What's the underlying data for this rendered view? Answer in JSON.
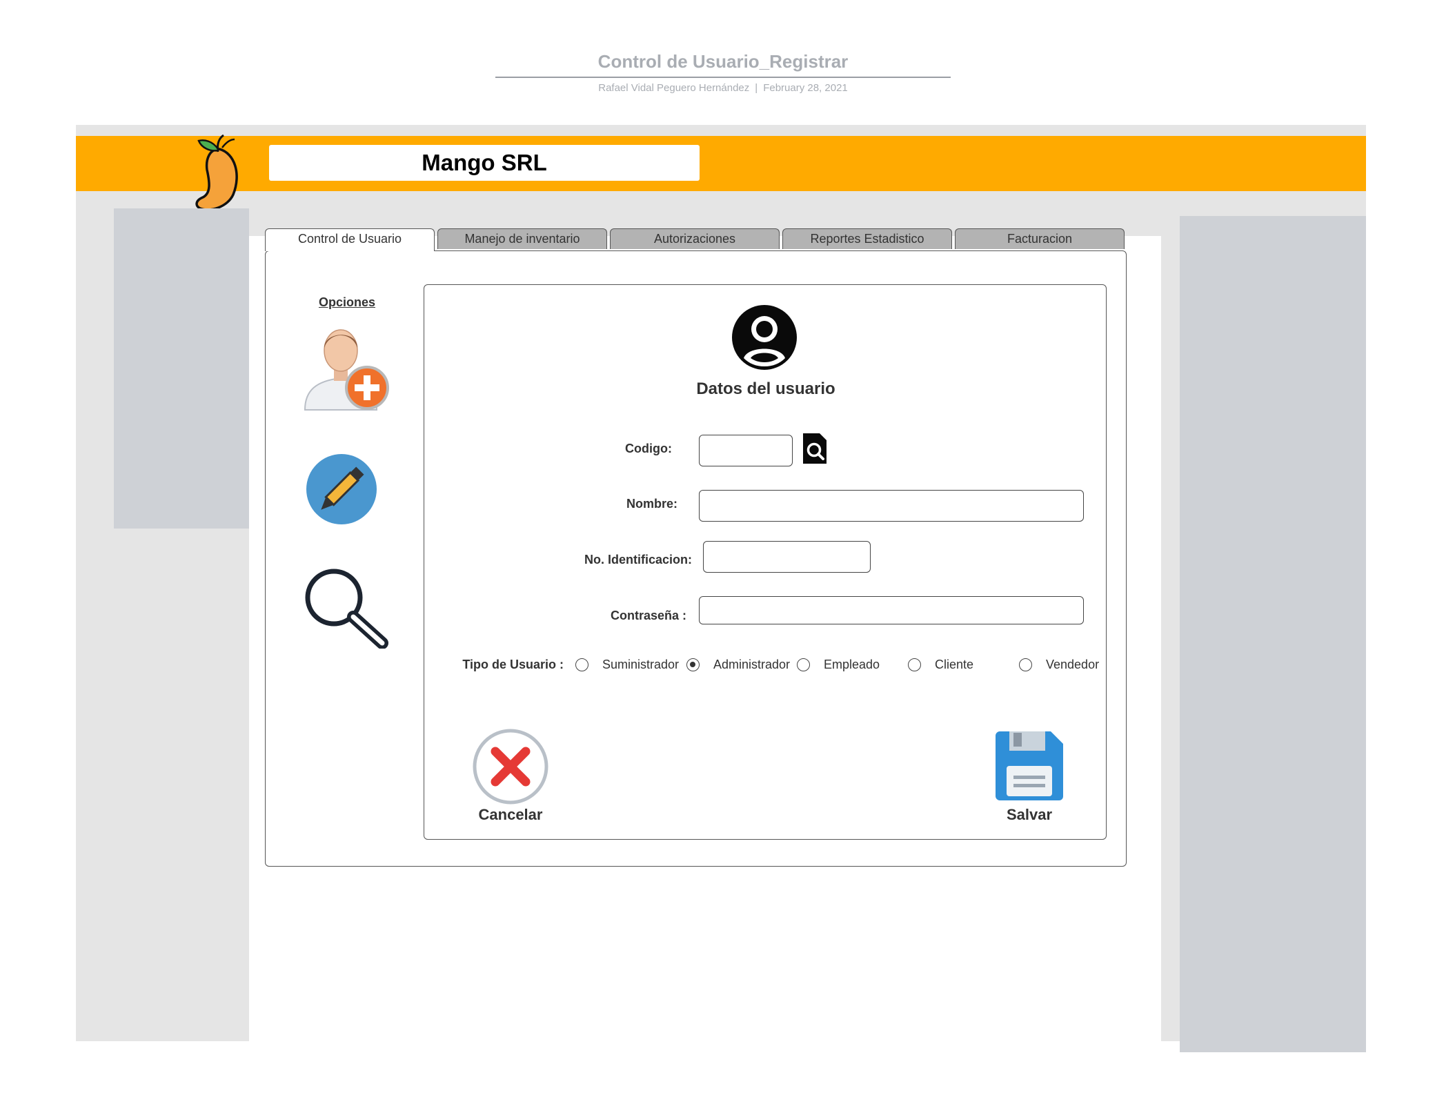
{
  "document": {
    "title": "Control de Usuario_Registrar",
    "author": "Rafael Vidal Peguero Hernández",
    "separator": "|",
    "date": "February 28, 2021"
  },
  "header": {
    "company_name": "Mango SRL",
    "color": "#ffaa00"
  },
  "tabs": [
    {
      "label": "Control de Usuario",
      "active": true
    },
    {
      "label": "Manejo de inventario",
      "active": false
    },
    {
      "label": "Autorizaciones",
      "active": false
    },
    {
      "label": "Reportes Estadistico",
      "active": false
    },
    {
      "label": "Facturacion",
      "active": false
    }
  ],
  "sidebar": {
    "title": "Opciones",
    "items": [
      {
        "icon": "add-user-icon"
      },
      {
        "icon": "pencil-icon"
      },
      {
        "icon": "magnifier-icon"
      }
    ]
  },
  "form": {
    "icon": "user-circle-icon",
    "heading": "Datos del usuario",
    "fields": {
      "codigo": {
        "label": "Codigo:",
        "value": ""
      },
      "nombre": {
        "label": "Nombre:",
        "value": ""
      },
      "identificacion": {
        "label": "No. Identificacion:",
        "value": ""
      },
      "contrasena": {
        "label": "Contraseña :",
        "value": ""
      }
    },
    "tipo_usuario": {
      "label": "Tipo de Usuario :",
      "options": [
        "Suministrador",
        "Administrador",
        "Empleado",
        "Cliente",
        "Vendedor"
      ],
      "selected": "Administrador"
    },
    "buttons": {
      "cancel": "Cancelar",
      "save": "Salvar"
    }
  },
  "colors": {
    "accent": "#ffaa00",
    "side_panel": "#ced1d6",
    "cancel_red": "#e53935",
    "save_blue": "#2f8fd8",
    "edit_circle": "#4a97cf"
  }
}
